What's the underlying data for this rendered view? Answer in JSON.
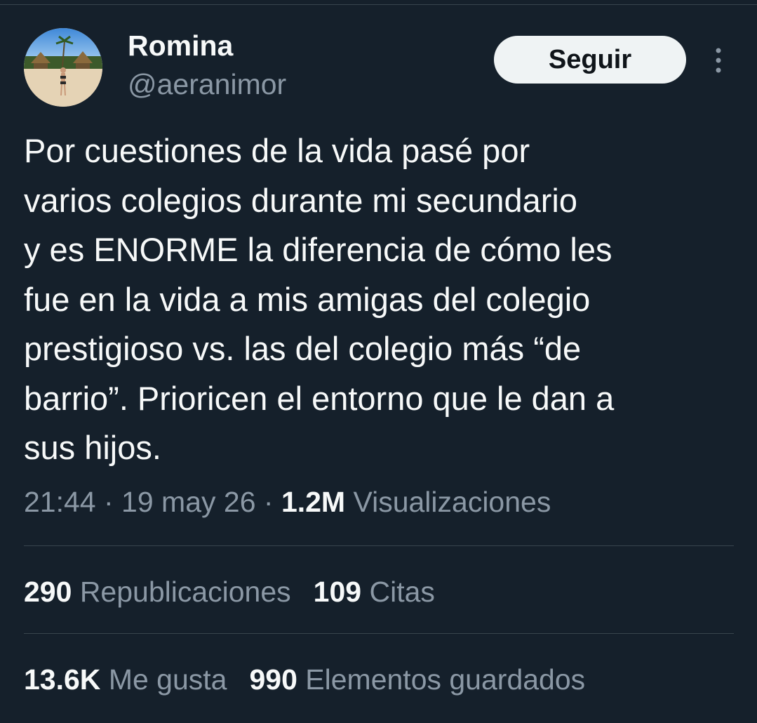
{
  "user": {
    "name": "Romina",
    "handle": "@aeranimor"
  },
  "follow_button": {
    "label": "Seguir"
  },
  "icons": {
    "more": "more-vertical-icon"
  },
  "tweet": {
    "text_lines": [
      "Por cuestiones de la vida pasé por",
      "varios colegios durante mi secundario",
      "y es ENORME la diferencia de cómo les",
      "fue en la vida a mis amigas del colegio",
      "prestigioso vs. las del colegio más “de",
      "barrio”. Prioricen el entorno que le dan a",
      "sus hijos."
    ]
  },
  "meta": {
    "time": "21:44",
    "sep1": " · ",
    "date": "19 may 26",
    "sep2": " · ",
    "views_count": "1.2M",
    "views_label": " Visualizaciones"
  },
  "stats": {
    "reposts_count": "290",
    "reposts_label": " Republicaciones",
    "quotes_count": "109",
    "quotes_label": " Citas",
    "likes_count": "13.6K",
    "likes_label": " Me gusta",
    "bookmarks_count": "990",
    "bookmarks_label": " Elementos guardados"
  },
  "colors": {
    "background": "#15202b",
    "primary_text": "#f7f9f9",
    "secondary_text": "#8b98a5",
    "divider": "#38444d",
    "button_bg": "#eff3f4",
    "button_text": "#0f1419"
  }
}
